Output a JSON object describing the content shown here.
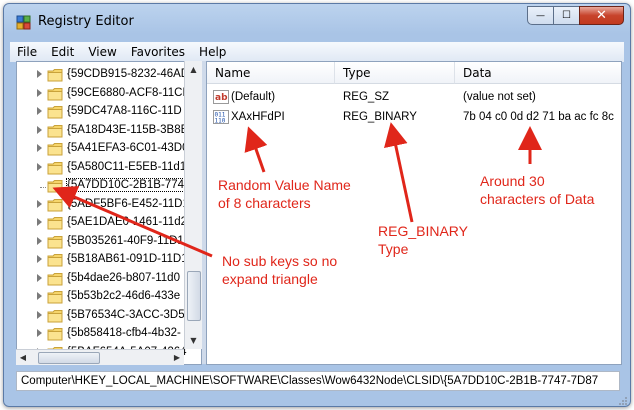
{
  "window": {
    "title": "Registry Editor"
  },
  "caption_buttons": {
    "minimize": "—",
    "maximize": "☐",
    "close": "✕"
  },
  "menu": [
    "File",
    "Edit",
    "View",
    "Favorites",
    "Help"
  ],
  "tree": [
    "{59CDB915-8232-46AD",
    "{59CE6880-ACF8-11CF",
    "{59DC47A8-116C-11D",
    "{5A18D43E-115B-3B8E",
    "{5A41EFA3-6C01-43D0",
    "{5A580C11-E5EB-11d1",
    "{5A7DD10C-2B1B-7747",
    "{5ADF5BF6-E452-11D1",
    "{5AE1DAE0-1461-11d2",
    "{5B035261-40F9-11D1-",
    "{5B18AB61-091D-11D1",
    "{5b4dae26-b807-11d0",
    "{5b53b2c2-46d6-433e",
    "{5B76534C-3ACC-3D5",
    "{5b858418-cfb4-4b32-",
    "{5BAF654A-5A07-4264"
  ],
  "tree_selected_index": 6,
  "list": {
    "headers": [
      "Name",
      "Type",
      "Data"
    ],
    "rows": [
      {
        "icon": "string-value-icon",
        "name": "(Default)",
        "type": "REG_SZ",
        "data": "(value not set)"
      },
      {
        "icon": "binary-value-icon",
        "name": "XAxHFdPI",
        "type": "REG_BINARY",
        "data": "7b 04 c0 0d d2 71 ba ac fc 8c"
      }
    ]
  },
  "statusbar": {
    "path": "Computer\\HKEY_LOCAL_MACHINE\\SOFTWARE\\Classes\\Wow6432Node\\CLSID\\{5A7DD10C-2B1B-7747-7D87"
  },
  "annotations": {
    "name_note": [
      "Random Value Name",
      "of 8 characters"
    ],
    "type_note": [
      "REG_BINARY",
      "Type"
    ],
    "data_note": [
      "Around 30",
      "characters of Data"
    ],
    "subkey_note": [
      "No sub keys so no",
      "expand triangle"
    ]
  },
  "colors": {
    "annotation": "#e0261a",
    "titlebar": "#a9c4e6"
  }
}
